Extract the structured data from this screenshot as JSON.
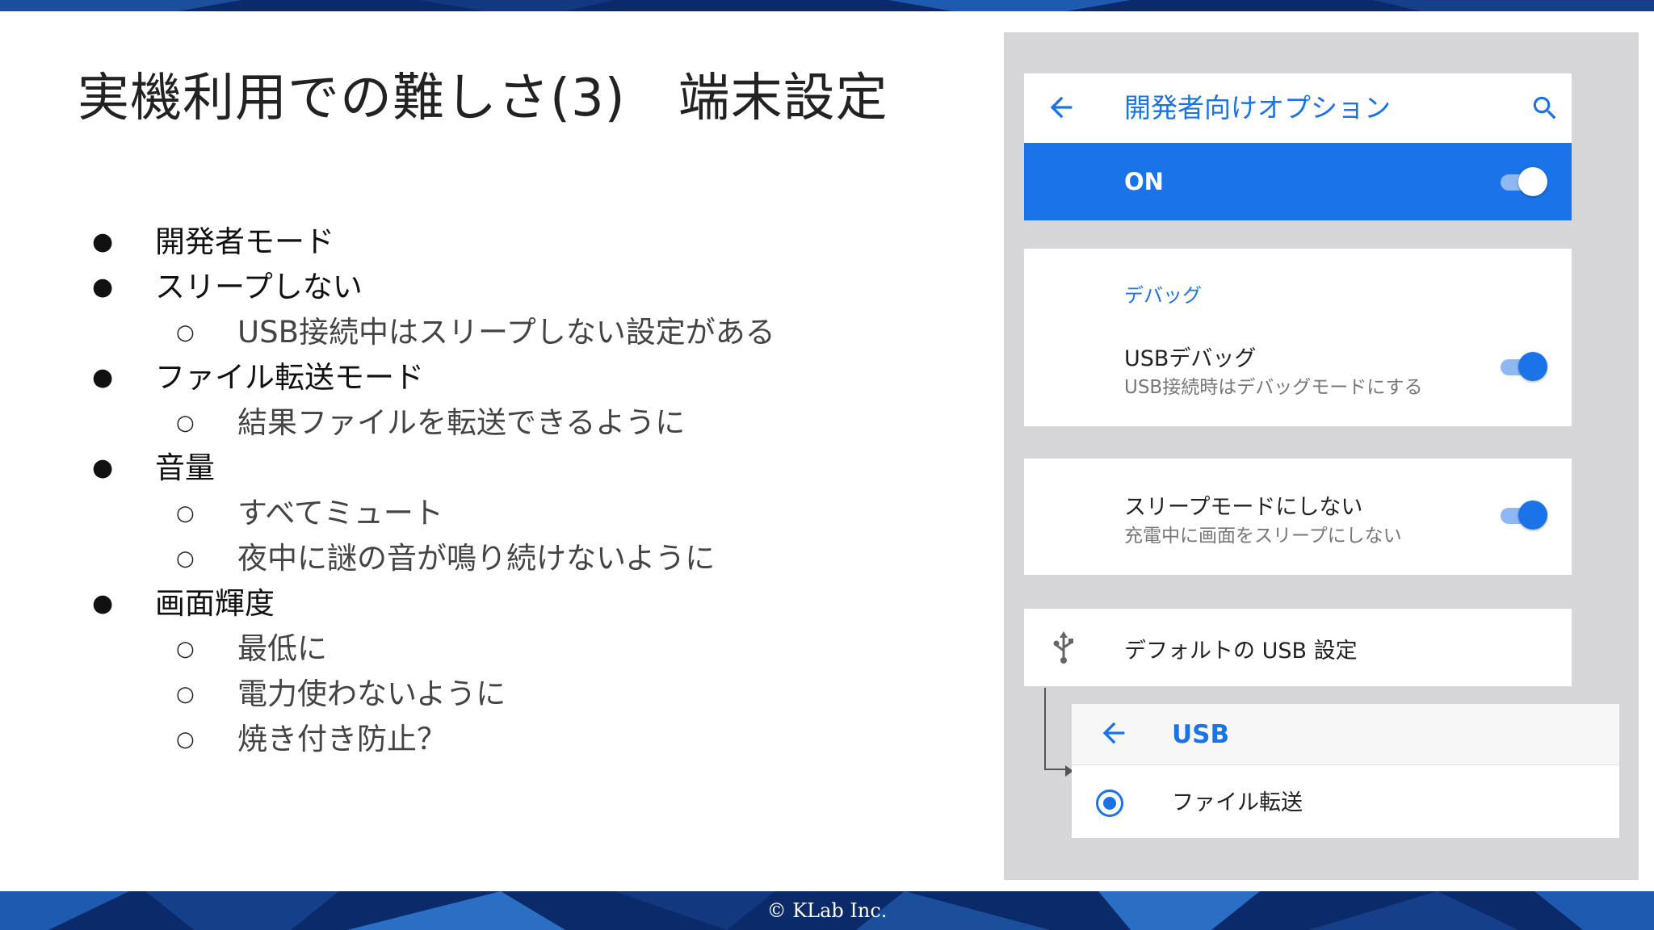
{
  "slide": {
    "title": "実機利用での難しさ(3)　端末設定",
    "copyright": "© KLab Inc."
  },
  "bullets": [
    {
      "level": 1,
      "mark": "●",
      "text": "開発者モード"
    },
    {
      "level": 1,
      "mark": "●",
      "text": "スリープしない"
    },
    {
      "level": 2,
      "mark": "○",
      "text": "USB接続中はスリープしない設定がある"
    },
    {
      "level": 1,
      "mark": "●",
      "text": "ファイル転送モード"
    },
    {
      "level": 2,
      "mark": "○",
      "text": "結果ファイルを転送できるように"
    },
    {
      "level": 1,
      "mark": "●",
      "text": "音量"
    },
    {
      "level": 2,
      "mark": "○",
      "text": "すべてミュート"
    },
    {
      "level": 2,
      "mark": "○",
      "text": "夜中に謎の音が鳴り続けないように"
    },
    {
      "level": 1,
      "mark": "●",
      "text": "画面輝度"
    },
    {
      "level": 2,
      "mark": "○",
      "text": "最低に"
    },
    {
      "level": 2,
      "mark": "○",
      "text": "電力使わないように"
    },
    {
      "level": 2,
      "mark": "○",
      "text": "焼き付き防止？"
    }
  ],
  "phone": {
    "appbar": {
      "back_icon": "arrow-left-icon",
      "title": "開発者向けオプション",
      "search_icon": "search-icon"
    },
    "master_switch": {
      "label": "ON",
      "state": "on"
    },
    "debug_section": {
      "header": "デバッグ",
      "usb_debug": {
        "title": "USBデバッグ",
        "subtitle": "USB接続時はデバッグモードにする",
        "state": "on"
      }
    },
    "stay_awake": {
      "title": "スリープモードにしない",
      "subtitle": "充電中に画面をスリープにしない",
      "state": "on"
    },
    "default_usb": {
      "icon": "usb-icon",
      "label": "デフォルトの USB 設定"
    },
    "usb_screen": {
      "back_icon": "arrow-left-icon",
      "title": "USB",
      "option_label": "ファイル転送",
      "selected": true
    }
  },
  "colors": {
    "accent": "#1a73e8",
    "panel_bg": "#d6d6d8",
    "band_dark": "#0b2a6a"
  }
}
